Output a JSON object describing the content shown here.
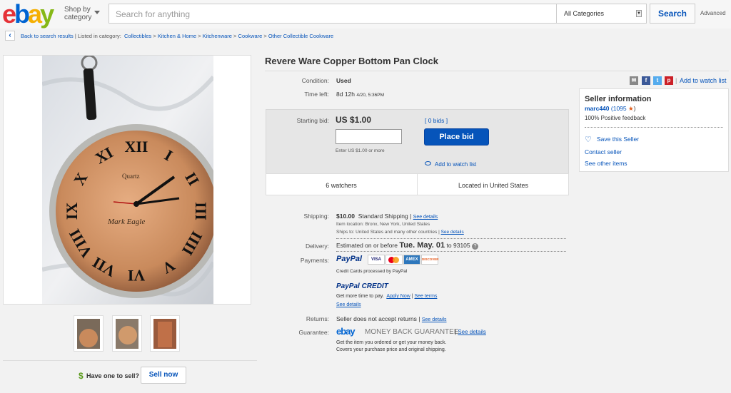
{
  "header": {
    "logo": [
      "e",
      "b",
      "a",
      "y"
    ],
    "shop_by_line1": "Shop by",
    "shop_by_line2": "category",
    "search_placeholder": "Search for anything",
    "category": "All Categories",
    "search_button": "Search",
    "advanced": "Advanced"
  },
  "breadcrumb": {
    "back": "Back to search results",
    "listed": "| Listed in category:",
    "crumbs": [
      "Collectibles",
      "Kitchen & Home",
      "Kitchenware",
      "Cookware",
      "Other Collectible Cookware"
    ],
    "separator": ">"
  },
  "item": {
    "title": "Revere Ware Copper Bottom Pan Clock",
    "condition_label": "Condition:",
    "condition": "Used",
    "time_left_label": "Time left:",
    "time_left": "8d 12h",
    "time_left_date": "4/20, 5:36PM"
  },
  "share": {
    "add_to_watch": "Add to watch list",
    "separator": "|"
  },
  "bid": {
    "label": "Starting bid:",
    "price": "US $1.00",
    "bids": "[ 0 bids ]",
    "hint": "Enter US $1.00 or more",
    "button": "Place bid",
    "watch": "Add to watch list",
    "watchers": "6 watchers",
    "location": "Located in United States"
  },
  "seller": {
    "heading": "Seller information",
    "name": "marc440",
    "score": "(1095",
    "score_close": ")",
    "feedback": "100% Positive feedback",
    "save": "Save this Seller",
    "contact": "Contact seller",
    "other": "See other items"
  },
  "shipping": {
    "label": "Shipping:",
    "cost": "$10.00",
    "method": "Standard Shipping",
    "sep": "|",
    "see": "See details",
    "location": "Item location:  Bronx, New York, United States",
    "ships": "Ships to:  United States and many other countries",
    "see2": "See details"
  },
  "delivery": {
    "label": "Delivery:",
    "prefix": "Estimated on or before",
    "date": "Tue. May. 01",
    "suffix": "to 93105"
  },
  "payments": {
    "label": "Payments:",
    "paypal": "PayPal",
    "cards": [
      "VISA",
      "MC",
      "AMEX",
      "DISCOVER"
    ],
    "processed": "Credit Cards processed by PayPal",
    "credit": "PayPal CREDIT",
    "more_time": "Get more time to pay.",
    "apply": "Apply Now",
    "terms": "See terms",
    "see": "See details"
  },
  "returns": {
    "label": "Returns:",
    "text": "Seller does not accept returns",
    "see": "See details"
  },
  "guarantee": {
    "label": "Guarantee:",
    "ebay": "ebay",
    "mbg": "MONEY BACK GUARANTEE",
    "see": "See details",
    "line1": "Get the item you ordered or get your money back.",
    "line2": "Covers your purchase price and original shipping."
  },
  "sell": {
    "symbol": "$",
    "text": "Have one to sell?",
    "button": "Sell now"
  },
  "photo": {
    "numerals": [
      "XII",
      "I",
      "II",
      "III",
      "IIII",
      "V",
      "VI",
      "VII",
      "VIII",
      "IX",
      "X",
      "XI"
    ],
    "brand": "Quartz",
    "script": "Mark Eagle"
  },
  "colors": {
    "link": "#0654ba",
    "bid_button": "#0654ba",
    "copper": "#c98a5c"
  }
}
